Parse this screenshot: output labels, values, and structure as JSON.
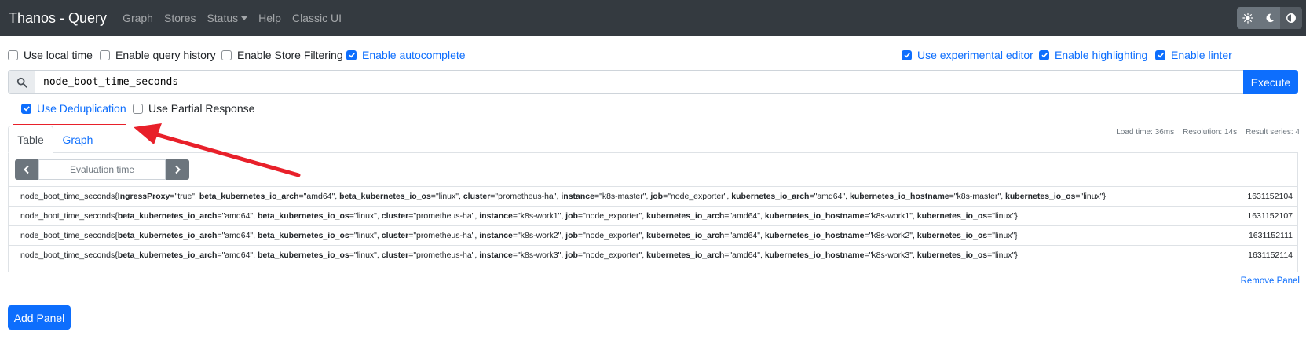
{
  "nav": {
    "brand": "Thanos - Query",
    "links": [
      "Graph",
      "Stores",
      "Status",
      "Help",
      "Classic UI"
    ]
  },
  "options": {
    "use_local_time": "Use local time",
    "enable_query_history": "Enable query history",
    "enable_store_filtering": "Enable Store Filtering",
    "enable_autocomplete": "Enable autocomplete",
    "use_experimental_editor": "Use experimental editor",
    "enable_highlighting": "Enable highlighting",
    "enable_linter": "Enable linter"
  },
  "query": {
    "expression": "node_boot_time_seconds",
    "execute_label": "Execute"
  },
  "panel_options": {
    "use_deduplication": "Use Deduplication",
    "use_partial_response": "Use Partial Response"
  },
  "stats": {
    "load_time": "Load time: 36ms",
    "resolution": "Resolution: 14s",
    "result_series": "Result series: 4"
  },
  "tabs": {
    "table": "Table",
    "graph": "Graph"
  },
  "eval": {
    "placeholder": "Evaluation time"
  },
  "results": [
    {
      "metric": "node_boot_time_seconds",
      "labels": [
        {
          "k": "IngressProxy",
          "v": "\"true\""
        },
        {
          "k": "beta_kubernetes_io_arch",
          "v": "\"amd64\""
        },
        {
          "k": "beta_kubernetes_io_os",
          "v": "\"linux\""
        },
        {
          "k": "cluster",
          "v": "\"prometheus-ha\""
        },
        {
          "k": "instance",
          "v": "\"k8s-master\""
        },
        {
          "k": "job",
          "v": "\"node_exporter\""
        },
        {
          "k": "kubernetes_io_arch",
          "v": "\"amd64\""
        },
        {
          "k": "kubernetes_io_hostname",
          "v": "\"k8s-master\""
        },
        {
          "k": "kubernetes_io_os",
          "v": "\"linux\""
        }
      ],
      "value": "1631152104"
    },
    {
      "metric": "node_boot_time_seconds",
      "labels": [
        {
          "k": "beta_kubernetes_io_arch",
          "v": "\"amd64\""
        },
        {
          "k": "beta_kubernetes_io_os",
          "v": "\"linux\""
        },
        {
          "k": "cluster",
          "v": "\"prometheus-ha\""
        },
        {
          "k": "instance",
          "v": "\"k8s-work1\""
        },
        {
          "k": "job",
          "v": "\"node_exporter\""
        },
        {
          "k": "kubernetes_io_arch",
          "v": "\"amd64\""
        },
        {
          "k": "kubernetes_io_hostname",
          "v": "\"k8s-work1\""
        },
        {
          "k": "kubernetes_io_os",
          "v": "\"linux\""
        }
      ],
      "value": "1631152107"
    },
    {
      "metric": "node_boot_time_seconds",
      "labels": [
        {
          "k": "beta_kubernetes_io_arch",
          "v": "\"amd64\""
        },
        {
          "k": "beta_kubernetes_io_os",
          "v": "\"linux\""
        },
        {
          "k": "cluster",
          "v": "\"prometheus-ha\""
        },
        {
          "k": "instance",
          "v": "\"k8s-work2\""
        },
        {
          "k": "job",
          "v": "\"node_exporter\""
        },
        {
          "k": "kubernetes_io_arch",
          "v": "\"amd64\""
        },
        {
          "k": "kubernetes_io_hostname",
          "v": "\"k8s-work2\""
        },
        {
          "k": "kubernetes_io_os",
          "v": "\"linux\""
        }
      ],
      "value": "1631152111"
    },
    {
      "metric": "node_boot_time_seconds",
      "labels": [
        {
          "k": "beta_kubernetes_io_arch",
          "v": "\"amd64\""
        },
        {
          "k": "beta_kubernetes_io_os",
          "v": "\"linux\""
        },
        {
          "k": "cluster",
          "v": "\"prometheus-ha\""
        },
        {
          "k": "instance",
          "v": "\"k8s-work3\""
        },
        {
          "k": "job",
          "v": "\"node_exporter\""
        },
        {
          "k": "kubernetes_io_arch",
          "v": "\"amd64\""
        },
        {
          "k": "kubernetes_io_hostname",
          "v": "\"k8s-work3\""
        },
        {
          "k": "kubernetes_io_os",
          "v": "\"linux\""
        }
      ],
      "value": "1631152114"
    }
  ],
  "remove_panel": "Remove Panel",
  "add_panel": "Add Panel",
  "colors": {
    "primary": "#0d6efd",
    "navbar": "#343a40",
    "annotation": "#e8202a"
  }
}
